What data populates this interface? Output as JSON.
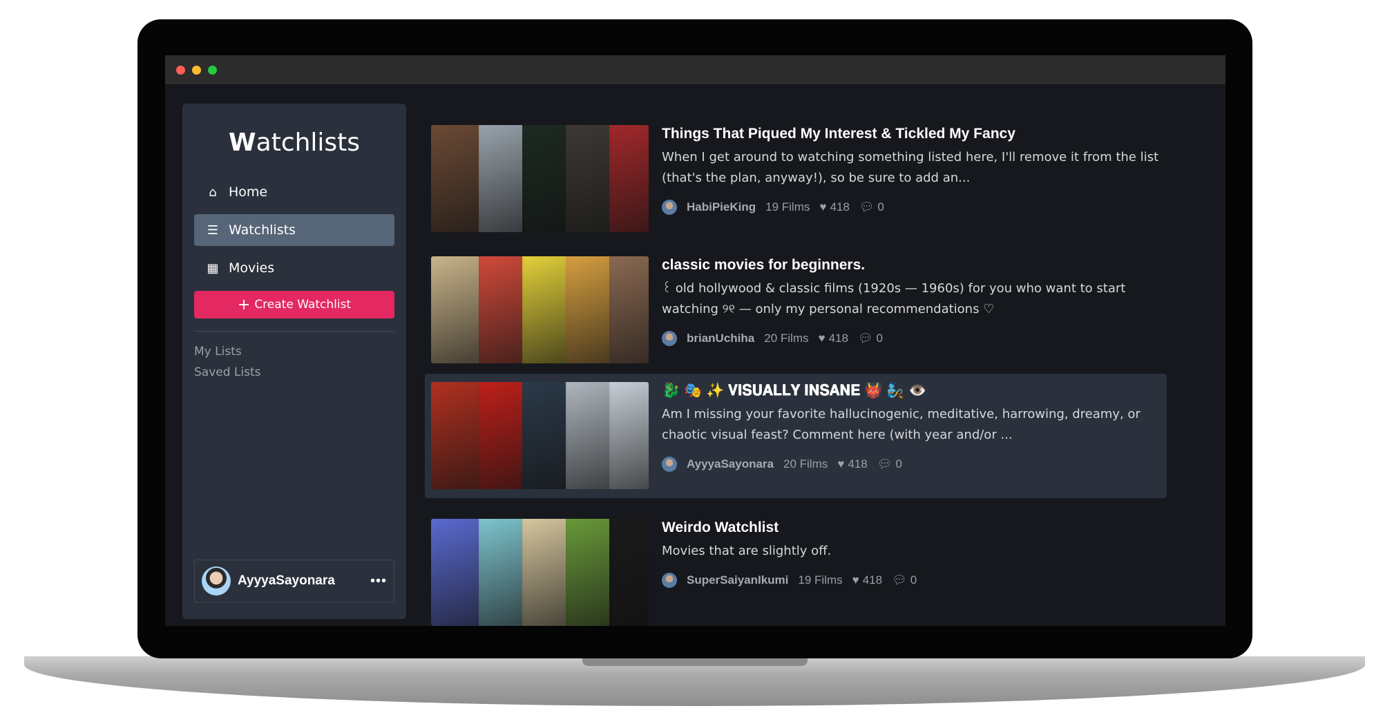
{
  "window": {
    "controls": [
      "#ff5f56",
      "#ffbd2e",
      "#27c93f"
    ]
  },
  "sidebar": {
    "logo_first": "W",
    "logo_rest": "atchlists",
    "nav": [
      {
        "label": "Home",
        "icon": "home-icon"
      },
      {
        "label": "Watchlists",
        "icon": "list-icon",
        "active": true
      },
      {
        "label": "Movies",
        "icon": "film-icon"
      }
    ],
    "create_label": "Create Watchlist",
    "sub": [
      "My Lists",
      "Saved Lists"
    ],
    "user": {
      "name": "AyyyaSayonara",
      "more": "•••"
    }
  },
  "accent": "#e32862",
  "lists": [
    {
      "title": "Things That Piqued My Interest & Tickled My Fancy",
      "desc": "When I get around to watching something listed here, I'll remove it from the list (that's the plan, anyway!), so be sure to add an...",
      "user": "HabiPieKing",
      "films": "19 Films",
      "likes": "418",
      "comments": "0",
      "posters": [
        "#6b4a35",
        "#9aa4ad",
        "#1d2a22",
        "#3d3a35",
        "#a3282a"
      ]
    },
    {
      "title": "classic movies for beginners.",
      "desc": "꒰ old hollywood & classic films (1920s — 1960s) for you who want to start watching ୨୧ — only my personal recommendations ♡",
      "user": "brianUchiha",
      "films": "20 Films",
      "likes": "418",
      "comments": "0",
      "posters": [
        "#c9b48a",
        "#d24a3a",
        "#e5d23a",
        "#d8a040",
        "#8c6a52"
      ]
    },
    {
      "title": "🐉 🎭 ✨ 𝐕𝐈𝐒𝐔𝐀𝐋𝐋𝐘 𝐈𝐍𝐒𝐀𝐍𝐄 👹 🧞 👁️",
      "desc": "Am I missing your favorite hallucinogenic, meditative, harrowing, dreamy, or chaotic visual feast? Comment here (with year and/or ...",
      "user": "AyyyaSayonara",
      "films": "20 Films",
      "likes": "418",
      "comments": "0",
      "highlighted": true,
      "posters": [
        "#b03020",
        "#c0201a",
        "#2c3a4a",
        "#b0b8c0",
        "#c8d0d8"
      ]
    },
    {
      "title": "Weirdo Watchlist",
      "desc": "Movies that are slightly off.",
      "user": "SuperSaiyanIkumi",
      "films": "19 Films",
      "likes": "418",
      "comments": "0",
      "posters": [
        "#5a6ad0",
        "#7fc6d0",
        "#d8c8a0",
        "#6a9a3a",
        "#1a1a1a"
      ]
    }
  ]
}
